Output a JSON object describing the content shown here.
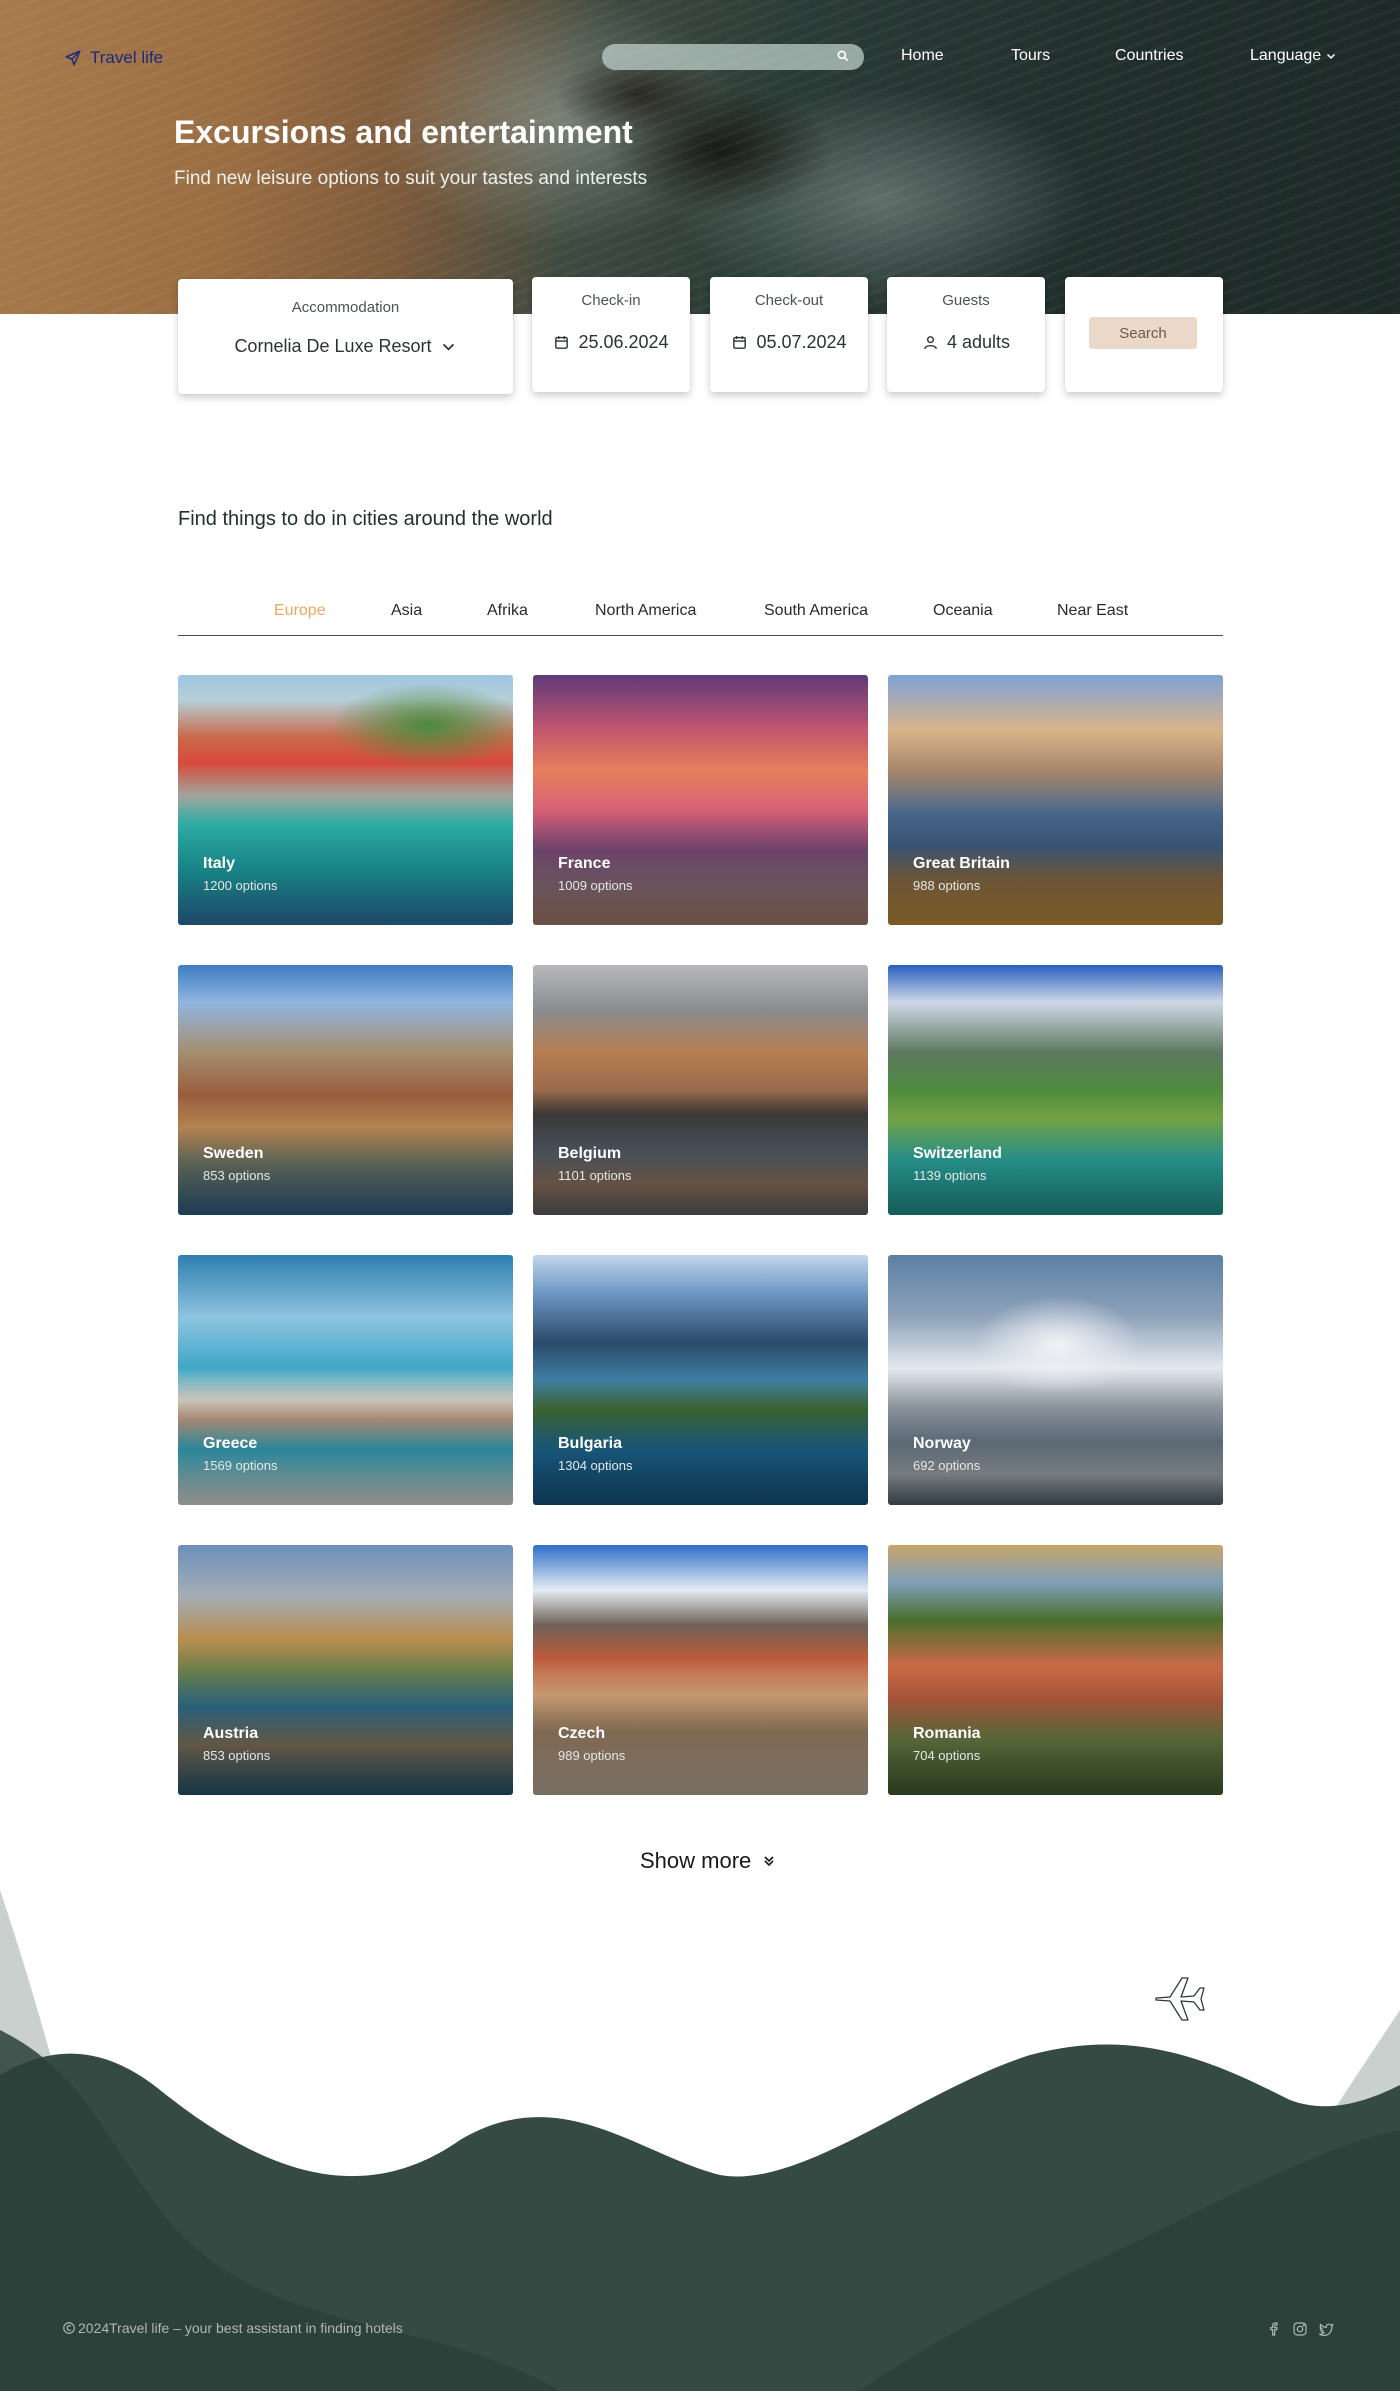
{
  "header": {
    "logo_text": "Travel life",
    "search_placeholder": "",
    "nav": {
      "home": "Home",
      "tours": "Tours",
      "countries": "Countries",
      "language": "Language"
    }
  },
  "hero": {
    "title": "Excursions and entertainment",
    "subtitle": "Find new leisure options to suit your tastes and interests"
  },
  "booking": {
    "accommodation": {
      "label": "Accommodation",
      "value": "Cornelia De Luxe Resort"
    },
    "check_in": {
      "label": "Check-in",
      "value": "25.06.2024"
    },
    "check_out": {
      "label": "Check-out",
      "value": "05.07.2024"
    },
    "guests": {
      "label": "Guests",
      "value": "4 adults"
    },
    "search_label": "Search"
  },
  "section": {
    "title": "Find things to do in cities around the world",
    "tabs": [
      "Europe",
      "Asia",
      "Afrika",
      "North America",
      "South America",
      "Oceania",
      "Near East"
    ],
    "active_tab": "Europe",
    "active_color": "#f0a65d"
  },
  "destinations": [
    {
      "name": "Italy",
      "options": "1200 options"
    },
    {
      "name": "France",
      "options": "1009 options"
    },
    {
      "name": "Great Britain",
      "options": "988 options"
    },
    {
      "name": "Sweden",
      "options": "853 options"
    },
    {
      "name": "Belgium",
      "options": "1101 options"
    },
    {
      "name": "Switzerland",
      "options": "1139 options"
    },
    {
      "name": "Greece",
      "options": "1569 options"
    },
    {
      "name": "Bulgaria",
      "options": "1304 options"
    },
    {
      "name": "Norway",
      "options": "692 options"
    },
    {
      "name": "Austria",
      "options": "853 options"
    },
    {
      "name": "Czech",
      "options": "989 options"
    },
    {
      "name": "Romania",
      "options": "704 options"
    }
  ],
  "show_more_label": "Show more",
  "footer": {
    "copyright": "2024Travel life – your best assistant in finding hotels",
    "socials": [
      "facebook-icon",
      "instagram-icon",
      "twitter-icon"
    ]
  },
  "colors": {
    "footer_dark": "#344a42",
    "footer_mid": "#2c4038",
    "footer_light": "#c9d0cd",
    "brand": "#1d2a7a"
  }
}
